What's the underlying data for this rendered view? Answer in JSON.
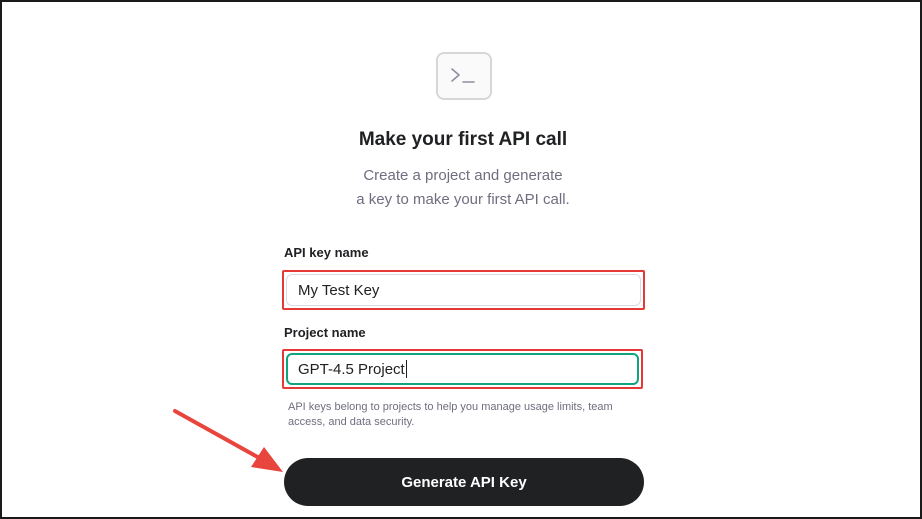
{
  "hero": {
    "icon": "terminal-icon",
    "title": "Make your first API call",
    "subtitle_line1": "Create a project and generate",
    "subtitle_line2": "a key to make your first API call."
  },
  "form": {
    "api_key_label": "API key name",
    "api_key_value": "My Test Key",
    "project_label": "Project name",
    "project_value": "GPT-4.5 Project",
    "helper_text": "API keys belong to projects to help you manage usage limits, team access, and data security."
  },
  "actions": {
    "generate_label": "Generate API Key"
  },
  "annotations": {
    "highlight_color": "#e53935",
    "arrow_color": "#e8453c",
    "arrow_target": "generate-api-key-button"
  },
  "colors": {
    "button_bg": "#202123",
    "focus_ring": "#10a37f",
    "muted_text": "#6e6e80"
  }
}
